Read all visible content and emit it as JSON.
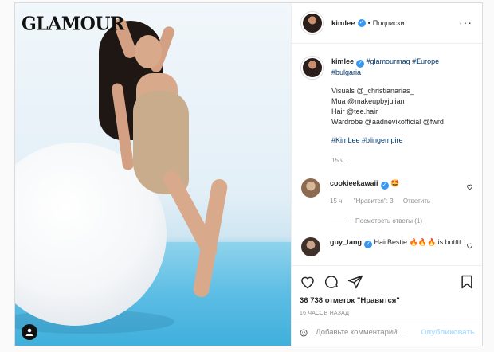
{
  "photo": {
    "brand_text": "GLAMOUR"
  },
  "header": {
    "username": "kimlee",
    "separator": "•",
    "follow_status": "Подписки",
    "more": "···"
  },
  "caption": {
    "username": "kimlee",
    "line1": "#glamourmag #Europe",
    "line2": "#bulgaria",
    "visuals": "Visuals @_christianarias_",
    "mua": "Mua @makeupbyjulian",
    "hair": "Hair @tee.hair",
    "wardrobe": "Wardrobe @aadnevikofficial @fwrd",
    "tags": "#KimLee #blingempire",
    "time": "15 ч."
  },
  "comments": [
    {
      "username": "cookieekawaii",
      "text": "🤩",
      "time": "15 ч.",
      "likes": "\"Нравится\": 3",
      "reply": "Ответить",
      "view_replies": "Посмотреть ответы (1)"
    },
    {
      "username": "guy_tang",
      "text": "HairBestie 🔥🔥🔥 is botttt"
    }
  ],
  "actions": {
    "likes": "36 738 отметок \"Нравится\"",
    "posted_ago": "16 ЧАСОВ НАЗАД"
  },
  "add_comment": {
    "placeholder": "Добавьте комментарий...",
    "post_label": "Опубликовать"
  },
  "colors": {
    "verified": "#3897f0",
    "link": "#00376b",
    "muted": "#8e8e8e",
    "post_disabled": "#b2dffc"
  }
}
